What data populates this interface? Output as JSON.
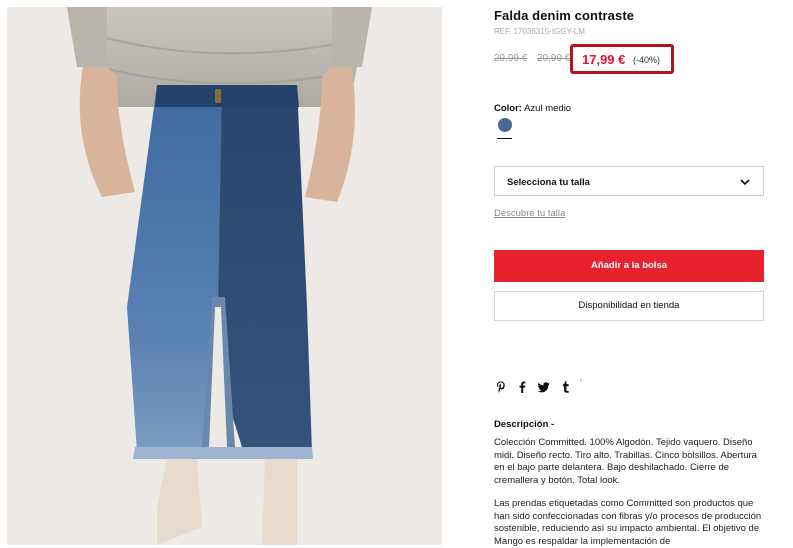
{
  "product": {
    "title": "Falda denim contraste",
    "ref": "REF. 17036315-IGGY-LM",
    "old_price_1": "29,99 €",
    "old_price_2": "20,99 €",
    "sale_price": "17,99 €",
    "discount": "(-40%)"
  },
  "color": {
    "label": "Color:",
    "value": "Azul medio",
    "swatch": "#4a6894"
  },
  "size": {
    "select_label": "Selecciona tu talla",
    "guide_link": "Descubre tu talla"
  },
  "actions": {
    "add_to_bag": "Añadir a la bolsa",
    "store_availability": "Disponibilidad en tienda"
  },
  "share_icons": [
    "pinterest-icon",
    "facebook-icon",
    "twitter-icon",
    "tumblr-icon"
  ],
  "description": {
    "title": "Descripción -",
    "paragraph1": "Colección Committed. 100% Algodón. Tejido vaquero. Diseño midi. Diseño recto. Tiro alto. Trabillas. Cinco bolsillos. Abertura en el bajo parte delantera. Bajo deshilachado. Cierre de cremallera y botón. Total look.",
    "paragraph2": "Las prendas etiquetadas como Committed son productos que han sido confeccionadas con fibras y/o procesos de producción sostenible, reduciendo así su impacto ambiental. El objetivo de Mango es respaldar la implementación de"
  },
  "colors": {
    "accent": "#e8212e",
    "sale_text": "#e6112d",
    "highlight_border": "#b5121b"
  }
}
